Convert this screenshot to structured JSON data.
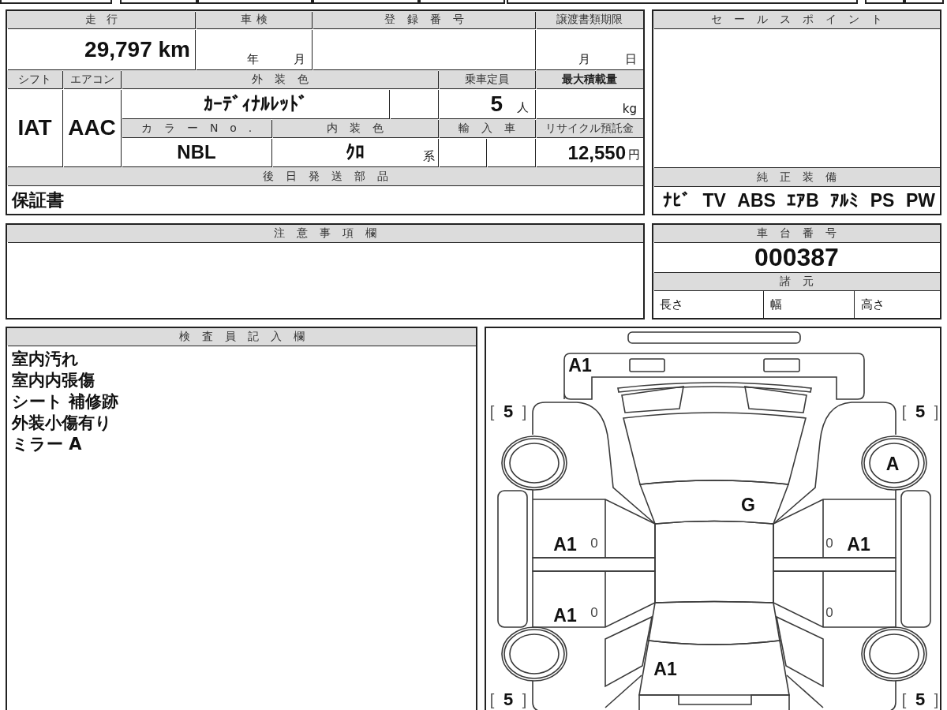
{
  "sheet": {
    "mileage": {
      "label": "走行",
      "value": "29,797 km"
    },
    "inspection": {
      "label": "車検",
      "year_unit": "年",
      "month_unit": "月"
    },
    "registration_number": {
      "label": "登録番号"
    },
    "transfer_deadline": {
      "label": "譲渡書類期限",
      "month_unit": "月",
      "day_unit": "日"
    },
    "shift": {
      "label": "シフト",
      "value": "IAT"
    },
    "air_conditioner": {
      "label": "エアコン",
      "value": "AAC"
    },
    "exterior_color": {
      "label": "外装色",
      "value": "ｶｰﾃﾞｨﾅﾙﾚｯﾄﾞ"
    },
    "seating_capacity": {
      "label": "乗車定員",
      "value": "5",
      "unit": "人"
    },
    "max_load": {
      "label": "最大積載量",
      "unit": "kg"
    },
    "color_number": {
      "label": "カラーNo.",
      "value": "NBL"
    },
    "interior_color": {
      "label": "内装色",
      "value": "ｸﾛ",
      "suffix": "系"
    },
    "imported": {
      "label": "輸入車"
    },
    "recycling_deposit": {
      "label": "リサイクル預託金",
      "value": "12,550",
      "unit": "円"
    },
    "parts_sent_later": {
      "label": "後日発送部品",
      "value": "保証書"
    }
  },
  "sales_points": {
    "label": "セールスポイント"
  },
  "factory_equipment": {
    "label": "純正装備",
    "items": [
      "ﾅﾋﾞ",
      "TV",
      "ABS",
      "ｴｱB",
      "ｱﾙﾐ",
      "PS",
      "PW"
    ]
  },
  "caution_notes": {
    "label": "注意事項欄"
  },
  "chassis_number": {
    "label": "車台番号",
    "value": "000387"
  },
  "specifications": {
    "label": "諸元",
    "fields": [
      "長さ",
      "幅",
      "高さ"
    ]
  },
  "inspector_notes": {
    "label": "検査員記入欄",
    "lines": [
      "室内汚れ",
      "室内内張傷",
      "シート 補修跡",
      "外装小傷有り",
      "ミラー A"
    ]
  },
  "damage_diagram": {
    "marks": [
      {
        "text": "A1",
        "kind": "grade"
      },
      {
        "text": "[ **5** ]",
        "kind": "tread"
      },
      {
        "text": "[ **5** ]",
        "kind": "tread"
      },
      {
        "text": "A",
        "kind": "grade"
      },
      {
        "text": "G",
        "kind": "grade"
      },
      {
        "text": "A1",
        "kind": "grade"
      },
      {
        "text": "0",
        "kind": "note"
      },
      {
        "text": "0",
        "kind": "note"
      },
      {
        "text": "A1",
        "kind": "grade"
      },
      {
        "text": "A1",
        "kind": "grade"
      },
      {
        "text": "0",
        "kind": "note"
      },
      {
        "text": "0",
        "kind": "note"
      },
      {
        "text": "A1",
        "kind": "grade"
      },
      {
        "text": "[ **5** ]",
        "kind": "tread"
      },
      {
        "text": "[ **5** ]",
        "kind": "tread"
      }
    ]
  }
}
